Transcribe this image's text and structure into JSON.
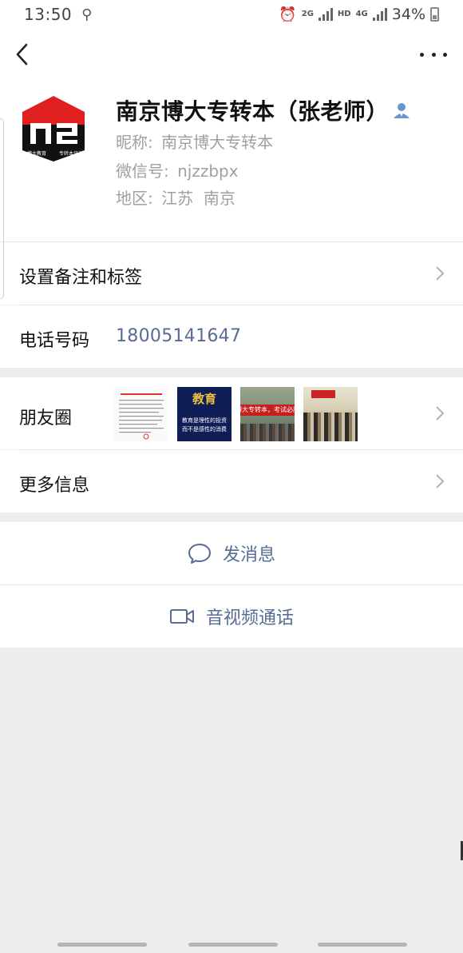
{
  "status_bar": {
    "time": "13:50",
    "network_2g": "2G",
    "hd": "HD",
    "network_4g": "4G",
    "battery": "34%"
  },
  "nav": {
    "back_icon": "chevron-left-icon",
    "more_icon": "more-dots-icon"
  },
  "profile": {
    "name": "南京博大专转本（张老师）",
    "nickname_label": "昵称:",
    "nickname": "南京博大专转本",
    "wechat_id_label": "微信号:",
    "wechat_id": "njzzbpx",
    "region_label": "地区:",
    "region": "江苏  南京",
    "avatar_tagline_left": "博大教育",
    "avatar_tagline_right": "专转本培训"
  },
  "rows": {
    "remark_label": "设置备注和标签",
    "phone_label": "电话号码",
    "phone_value": "18005141647",
    "moments_label": "朋友圈",
    "more_info_label": "更多信息"
  },
  "moments_thumbs": {
    "thumb2_title": "教育",
    "thumb2_line1": "教育是理性的投资",
    "thumb2_line2": "而不是感性的消费",
    "thumb3_banner": "博大专转本，考试必胜"
  },
  "actions": {
    "send_message": "发消息",
    "video_call": "音视频通话"
  },
  "colors": {
    "link": "#576b95",
    "background": "#ededed",
    "brand_red": "#e02020"
  }
}
